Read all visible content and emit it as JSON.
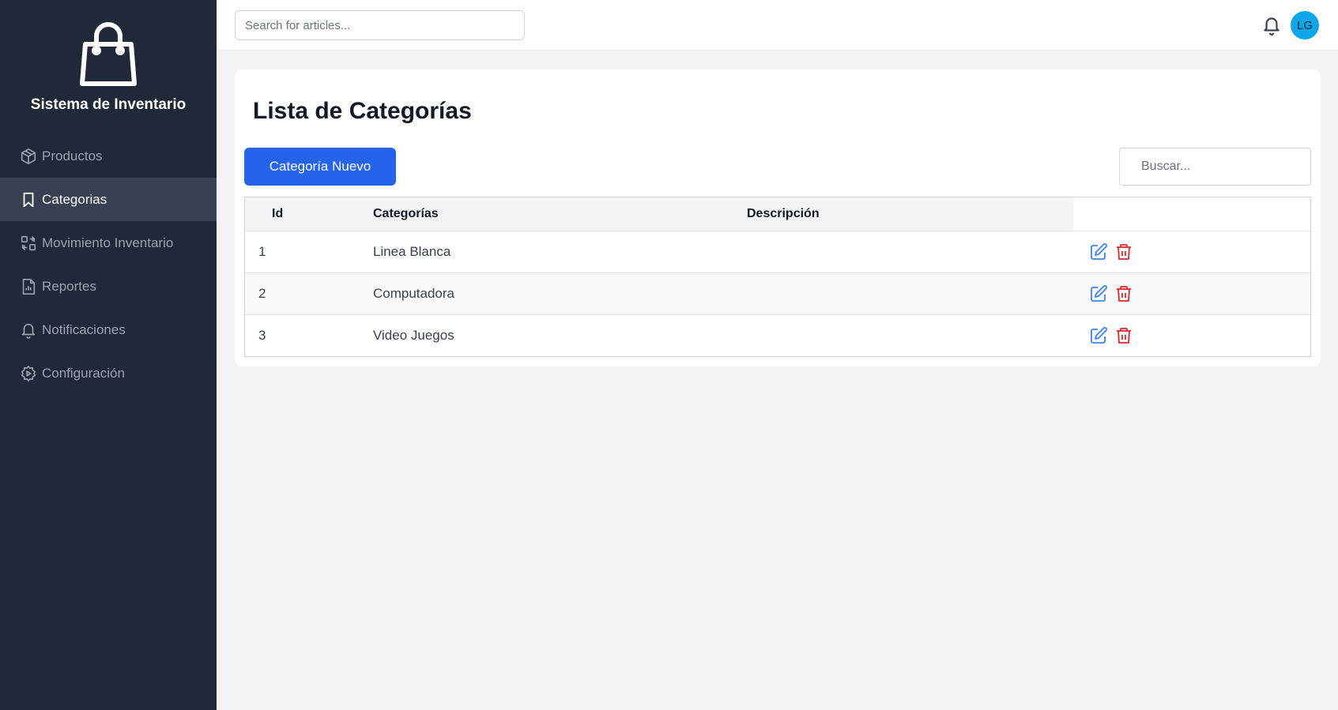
{
  "app": {
    "title": "Sistema de Inventario",
    "logo_icon": "shopping-bag-icon"
  },
  "sidebar": {
    "items": [
      {
        "label": "Productos",
        "icon": "cube-icon",
        "active": false
      },
      {
        "label": "Categorias",
        "icon": "bookmark-icon",
        "active": true
      },
      {
        "label": "Movimiento Inventario",
        "icon": "arrows-exchange-icon",
        "active": false
      },
      {
        "label": "Reportes",
        "icon": "report-document-icon",
        "active": false
      },
      {
        "label": "Notificaciones",
        "icon": "bell-icon",
        "active": false
      },
      {
        "label": "Configuración",
        "icon": "gear-icon",
        "active": false
      }
    ]
  },
  "topbar": {
    "search_placeholder": "Search for articles...",
    "notification_icon": "bell-icon",
    "avatar_initials": "LG"
  },
  "page": {
    "title": "Lista de Categorías",
    "new_button_label": "Categoría Nuevo",
    "search_placeholder": "Buscar..."
  },
  "table": {
    "headers": {
      "id": "Id",
      "category": "Categorías",
      "description": "Descripción"
    },
    "rows": [
      {
        "id": "1",
        "category": "Linea Blanca",
        "description": ""
      },
      {
        "id": "2",
        "category": "Computadora",
        "description": ""
      },
      {
        "id": "3",
        "category": "Video Juegos",
        "description": ""
      }
    ],
    "actions": {
      "edit_icon": "edit-icon",
      "delete_icon": "trash-icon"
    }
  },
  "colors": {
    "sidebar_bg": "#1f2937",
    "sidebar_active": "#374151",
    "primary": "#2563eb",
    "avatar": "#0ea5e9",
    "edit": "#3b82f6",
    "delete": "#dc2626"
  }
}
